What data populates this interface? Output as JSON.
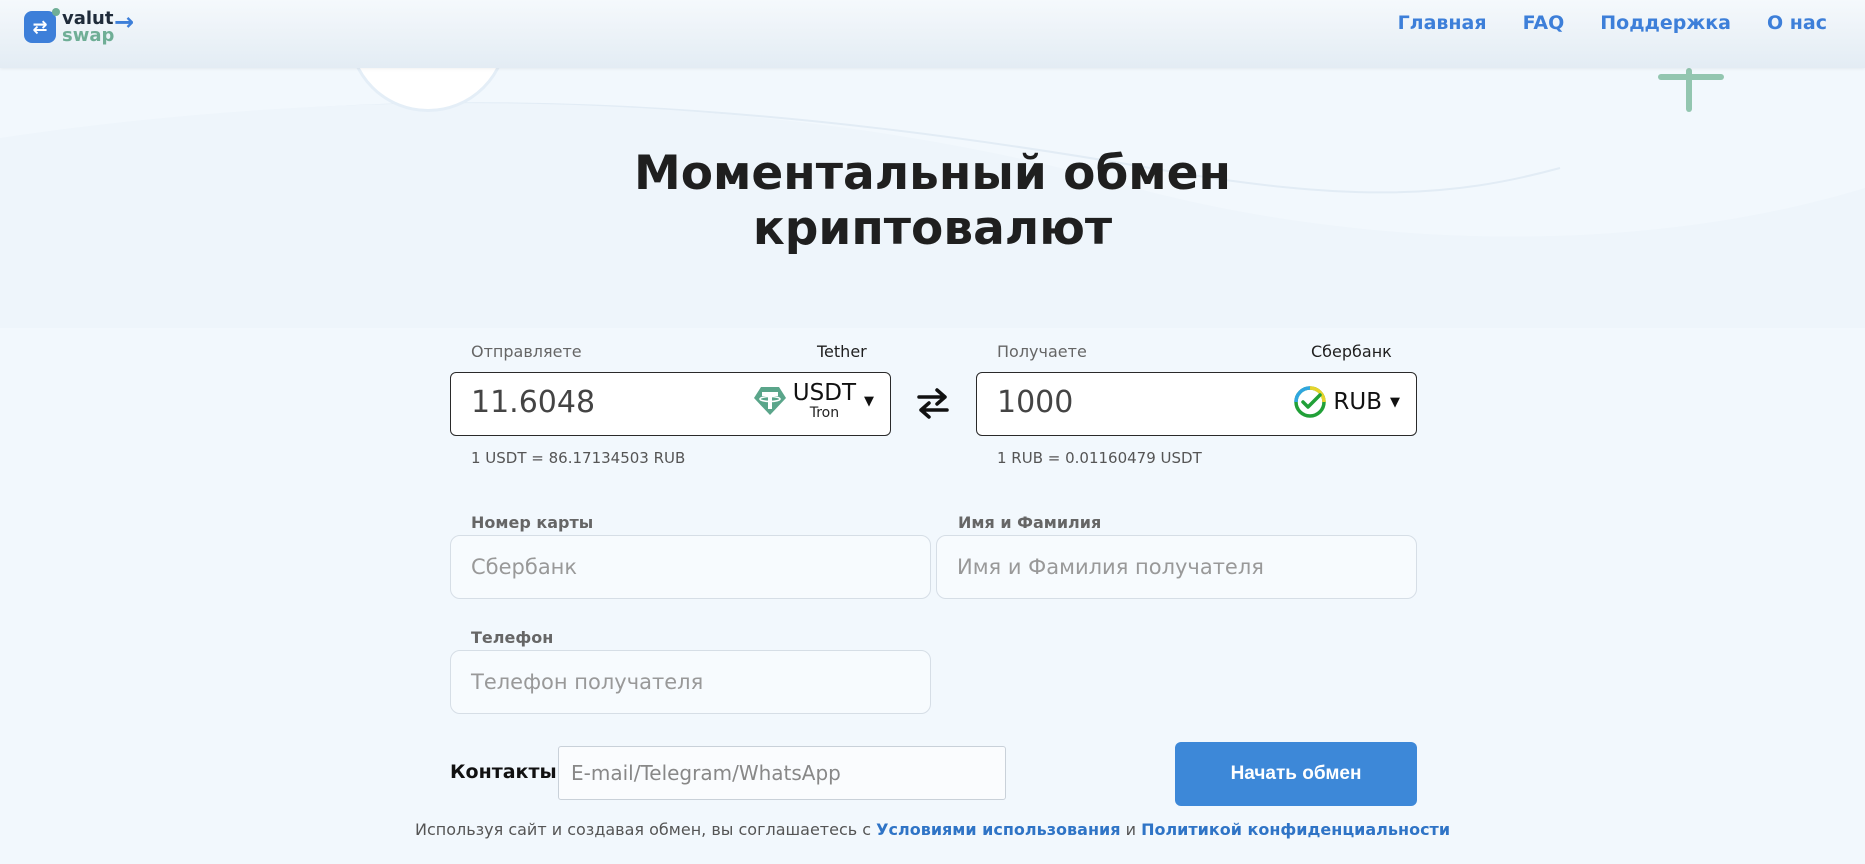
{
  "header": {
    "logo": {
      "line1": "valut",
      "line2": "swap"
    },
    "nav": [
      "Главная",
      "FAQ",
      "Поддержка",
      "О нас"
    ]
  },
  "hero": {
    "title_line1": "Моментальный обмен",
    "title_line2": "криптовалют"
  },
  "send": {
    "label": "Отправляете",
    "provider": "Tether",
    "amount": "11.6048",
    "currency": "USDT",
    "network": "Tron",
    "icon": "tether-icon",
    "rate": "1 USDT = 86.17134503 RUB"
  },
  "receive": {
    "label": "Получаете",
    "provider": "Сбербанк",
    "amount": "1000",
    "currency": "RUB",
    "icon": "sberbank-icon",
    "rate": "1 RUB = 0.01160479 USDT"
  },
  "form": {
    "card_label": "Номер карты",
    "card_placeholder": "Сбербанк",
    "name_label": "Имя и Фамилия",
    "name_placeholder": "Имя и Фамилия получателя",
    "phone_label": "Телефон",
    "phone_placeholder": "Телефон получателя",
    "contacts_label": "Контакты",
    "contacts_placeholder": "E-mail/Telegram/WhatsApp",
    "submit_label": "Начать обмен"
  },
  "agreement": {
    "text_before": "Используя сайт и создавая обмен, вы соглашаетесь с ",
    "terms_link": "Условиями использования",
    "conjunction": " и ",
    "privacy_link": "Политикой конфиденциальности"
  },
  "colors": {
    "accent": "#3d7fd9",
    "button": "#3d88d8",
    "brand_green": "#6fae96",
    "background": "#f2f8fd"
  }
}
